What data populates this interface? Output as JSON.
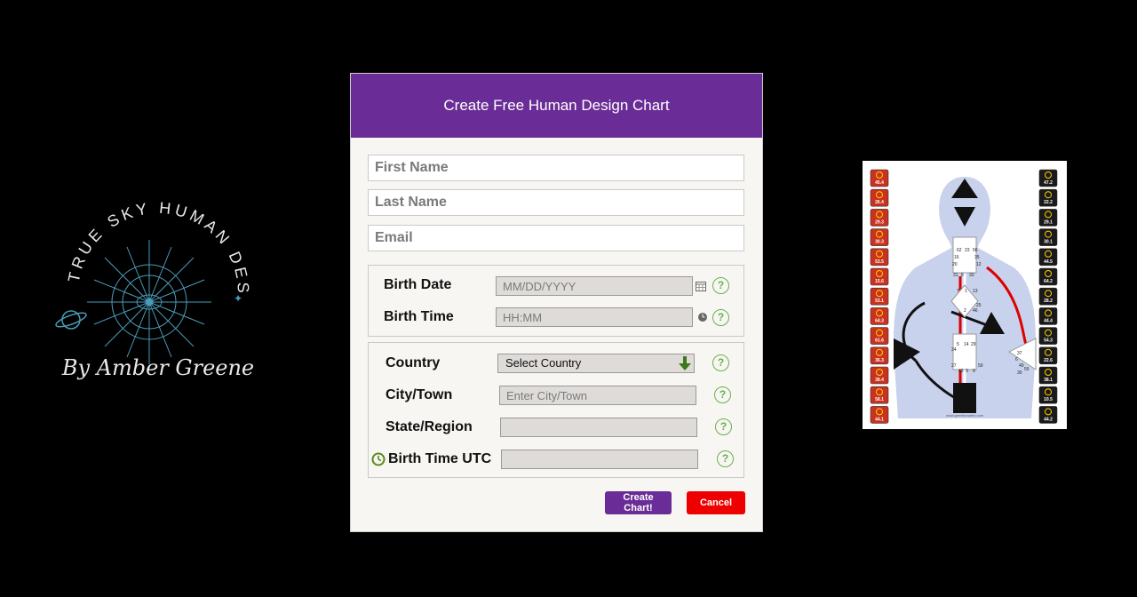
{
  "logo": {
    "arc_text": "TRUE SKY HUMAN DESIGN",
    "script_text": "By Amber Greene"
  },
  "modal": {
    "title": "Create Free Human Design Chart",
    "first_name_placeholder": "First Name",
    "last_name_placeholder": "Last Name",
    "email_placeholder": "Email",
    "birth_date_label": "Birth Date",
    "birth_date_placeholder": "MM/DD/YYYY",
    "birth_time_label": "Birth Time",
    "birth_time_placeholder": "HH:MM",
    "country_label": "Country",
    "country_selected": "Select Country",
    "city_label": "City/Town",
    "city_placeholder": "Enter City/Town",
    "state_label": "State/Region",
    "utc_label": "Birth Time UTC",
    "help_glyph": "?",
    "create_button": "Create Chart!",
    "cancel_button": "Cancel"
  },
  "chart_image": {
    "left_values": [
      "45.4",
      "26.4",
      "29.3",
      "30.3",
      "53.5",
      "15.6",
      "53.1",
      "64.3",
      "61.6",
      "36.3",
      "38.4",
      "58.1",
      "44.1"
    ],
    "right_values": [
      "47.2",
      "22.2",
      "29.1",
      "30.1",
      "44.5",
      "64.2",
      "28.2",
      "44.4",
      "54.3",
      "22.6",
      "38.1",
      "10.5",
      "44.2"
    ],
    "center_numbers": [
      "62",
      "23",
      "56",
      "16",
      "35",
      "20",
      "12",
      "31",
      "8",
      "33",
      "7",
      "1",
      "13",
      "25",
      "2",
      "46",
      "5",
      "14",
      "29",
      "34",
      "27",
      "42",
      "3",
      "9",
      "59",
      "37",
      "6",
      "49",
      "55",
      "30"
    ],
    "footer": "www.geneticmatrix.com"
  },
  "colors": {
    "header": "#6a2c96",
    "cancel": "#ee0000",
    "help": "#6ab04c"
  }
}
